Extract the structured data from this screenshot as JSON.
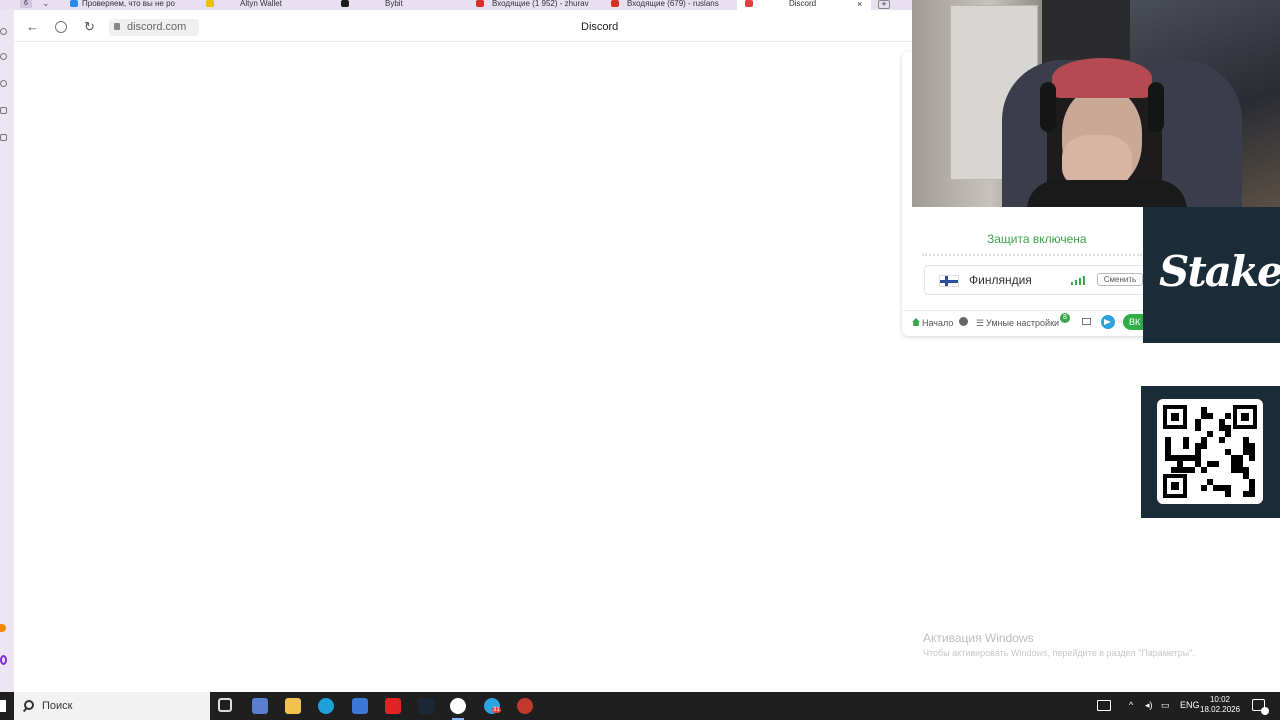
{
  "browser": {
    "tab_count": "6",
    "tabs": [
      {
        "label": "Проверяем, что вы не ро",
        "color": "#2787f5"
      },
      {
        "label": "Altyn Wallet",
        "color": "#f0c000"
      },
      {
        "label": "Bybit",
        "color": "#1b1b1b"
      },
      {
        "label": "Входящие (1 952) - zhurav",
        "color": "#d93025"
      },
      {
        "label": "Входящие (679) - ruslans",
        "color": "#d93025"
      },
      {
        "label": "Discord",
        "color": "#e04040"
      }
    ],
    "url": "discord.com",
    "page_title": "Discord",
    "tab_close": "×",
    "tab_new": "+"
  },
  "vpn": {
    "status": "Защита включена",
    "country": "Финляндия",
    "change_label": "Сменить",
    "footer": {
      "home": "Начало",
      "settings": "Умные настройки",
      "settings_badge": "8",
      "vk": "ВК"
    },
    "accent": "#3aa64a"
  },
  "overlay": {
    "stake_logo": "Stake"
  },
  "watermark": {
    "title": "Активация Windows",
    "subtitle": "Чтобы активировать Windows, перейдите в раздел \"Параметры\"."
  },
  "taskbar": {
    "search_label": "Поиск",
    "lang": "ENG",
    "time": "10:02",
    "date": "18.02.2026",
    "telegram_badge": "31"
  }
}
